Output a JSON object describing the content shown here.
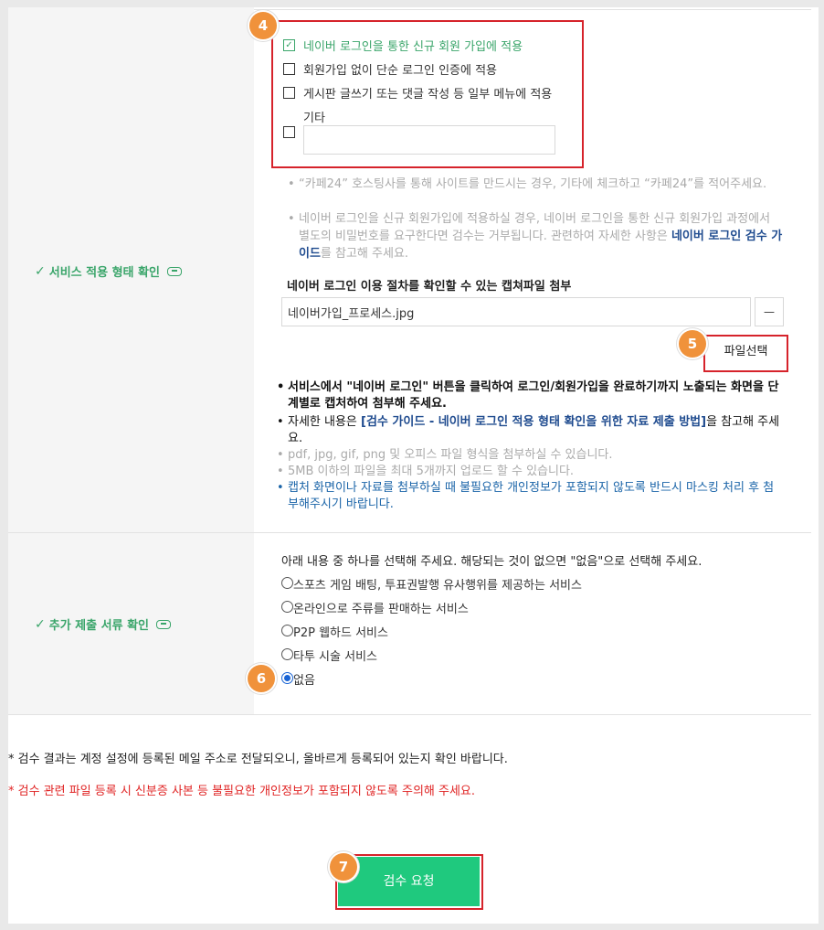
{
  "service_section": {
    "label": "서비스 적용 형태 확인",
    "options": [
      {
        "label": "네이버 로그인을 통한 신규 회원 가입에 적용",
        "checked": true
      },
      {
        "label": "회원가입 없이 단순 로그인 인증에 적용",
        "checked": false
      },
      {
        "label": "게시판 글쓰기 또는 댓글 작성 등 일부 메뉴에 적용",
        "checked": false
      },
      {
        "label": "기타",
        "checked": false
      }
    ],
    "etc_value": "",
    "help_1": "“카페24” 호스팅사를 통해 사이트를 만드시는 경우, 기타에 체크하고 “카페24”를 적어주세요.",
    "help_2a": "네이버 로그인을 신규 회원가입에 적용하실 경우, 네이버 로그인을 통한 신규 회원가입 과정에서 별도의 비밀번호를 요구한다면 검수는 거부됩니다. 관련하여 자세한 사항은 ",
    "help_2_link": "네이버 로그인 검수 가이드",
    "help_2b": "를 참고해 주세요.",
    "attach_title": "네이버 로그인 이용 절차를 확인할 수 있는 캡쳐파일 첨부",
    "file_name": "네이버가입_프로세스.jpg",
    "remove_label": "—",
    "file_select_label": "파일선택",
    "bullets": {
      "b1": "서비스에서 \"네이버 로그인\" 버튼을 클릭하여 로그인/회원가입을 완료하기까지 노출되는 화면을 단계별로 캡처하여 첨부해 주세요.",
      "b2a": "자세한 내용은 ",
      "b2_link": "[검수 가이드  -  네이버 로그인 적용 형태 확인을 위한 자료 제출 방법]",
      "b2b": "을 참고해 주세요.",
      "b3": "pdf, jpg, gif, png 및 오피스 파일 형식을 첨부하실 수 있습니다.",
      "b4": "5MB 이하의 파일을 최대 5개까지 업로드 할 수 있습니다.",
      "b5": "캡처 화면이나 자료를 첨부하실 때 불필요한 개인정보가 포함되지 않도록 반드시 마스킹 처리 후 첨부해주시기 바랍니다."
    }
  },
  "extra_section": {
    "label": "추가 제출 서류 확인",
    "instruction": "아래 내용 중 하나를 선택해 주세요. 해당되는 것이 없으면 \"없음\"으로 선택해 주세요.",
    "options": [
      {
        "label": "스포츠 게임 배팅, 투표권발행 유사행위를 제공하는 서비스",
        "selected": false
      },
      {
        "label": "온라인으로 주류를 판매하는 서비스",
        "selected": false
      },
      {
        "label": "P2P 웹하드 서비스",
        "selected": false
      },
      {
        "label": "타투 시술 서비스",
        "selected": false
      },
      {
        "label": "없음",
        "selected": true
      }
    ]
  },
  "notes": {
    "note1": "* 검수 결과는 계정 설정에 등록된 메일 주소로 전달되오니, 올바르게 등록되어 있는지 확인 바랍니다.",
    "note2": "* 검수 관련 파일 등록 시 신분증 사본 등 불필요한 개인정보가 포함되지 않도록 주의해 주세요."
  },
  "submit_label": "검수 요청",
  "badges": [
    "4",
    "5",
    "6",
    "7"
  ],
  "colors": {
    "accent_green": "#3aa56a",
    "submit_green": "#1fc97e",
    "highlight_red": "#d6232b",
    "badge_orange": "#f0923b",
    "link_blue": "#1f4b8f",
    "notice_blue": "#1a64a8"
  }
}
